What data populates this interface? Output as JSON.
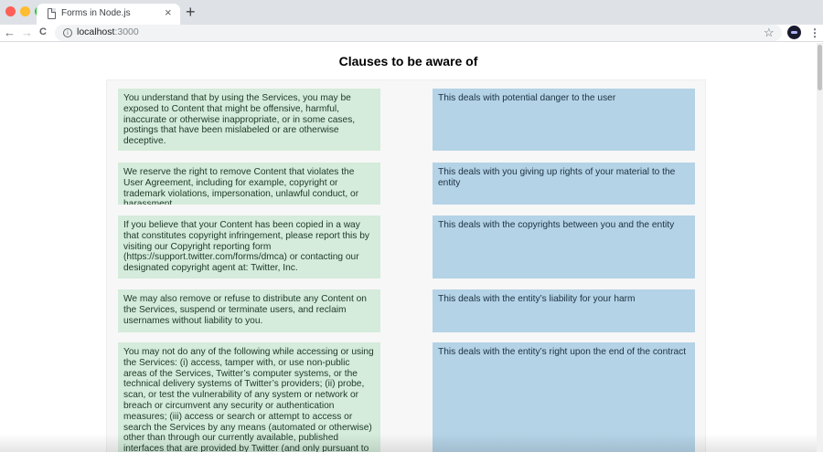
{
  "browser": {
    "tab_title": "Forms in Node.js",
    "tab_close": "×",
    "new_tab": "+",
    "back": "←",
    "forward": "→",
    "reload": "C",
    "info": "i",
    "url_host": "localhost",
    "url_port": ":3000",
    "star": "☆",
    "menu": "⋮",
    "traffic_colors": [
      "#fe5f57",
      "#febc2e",
      "#28c840"
    ]
  },
  "page": {
    "title": "Clauses to be aware of",
    "clauses": [
      "You understand that by using the Services, you may be exposed to Content that might be offensive, harmful, inaccurate or otherwise inappropriate, or in some cases, postings that have been mislabeled or are otherwise deceptive.",
      "We reserve the right to remove Content that violates the User Agreement, including for example, copyright or trademark violations, impersonation, unlawful conduct, or harassment.",
      "If you believe that your Content has been copied in a way that constitutes copyright infringement, please report this by visiting our Copyright reporting form (https://support.twitter.com/forms/dmca) or contacting our designated copyright agent at: Twitter, Inc.",
      "We may also remove or refuse to distribute any Content on the Services, suspend or terminate users, and reclaim usernames without liability to you.",
      "You may not do any of the following while accessing or using the Services: (i) access, tamper with, or use non-public areas of the Services, Twitter’s computer systems, or the technical delivery systems of Twitter’s providers; (ii) probe, scan, or test the vulnerability of any system or network or breach or circumvent any security or authentication measures; (iii) access or search or attempt to access or search the Services by any means (automated or otherwise) other than through our currently available, published interfaces that are provided by Twitter (and only pursuant to the applicable terms and"
    ],
    "meanings": [
      "This deals with potential danger to the user",
      "This deals with you giving up rights of your material to the entity",
      "This deals with the copyrights between you and the entity",
      "This deals with the entity’s liability for your harm",
      "This deals with the entity’s right upon the end of the contract"
    ]
  }
}
